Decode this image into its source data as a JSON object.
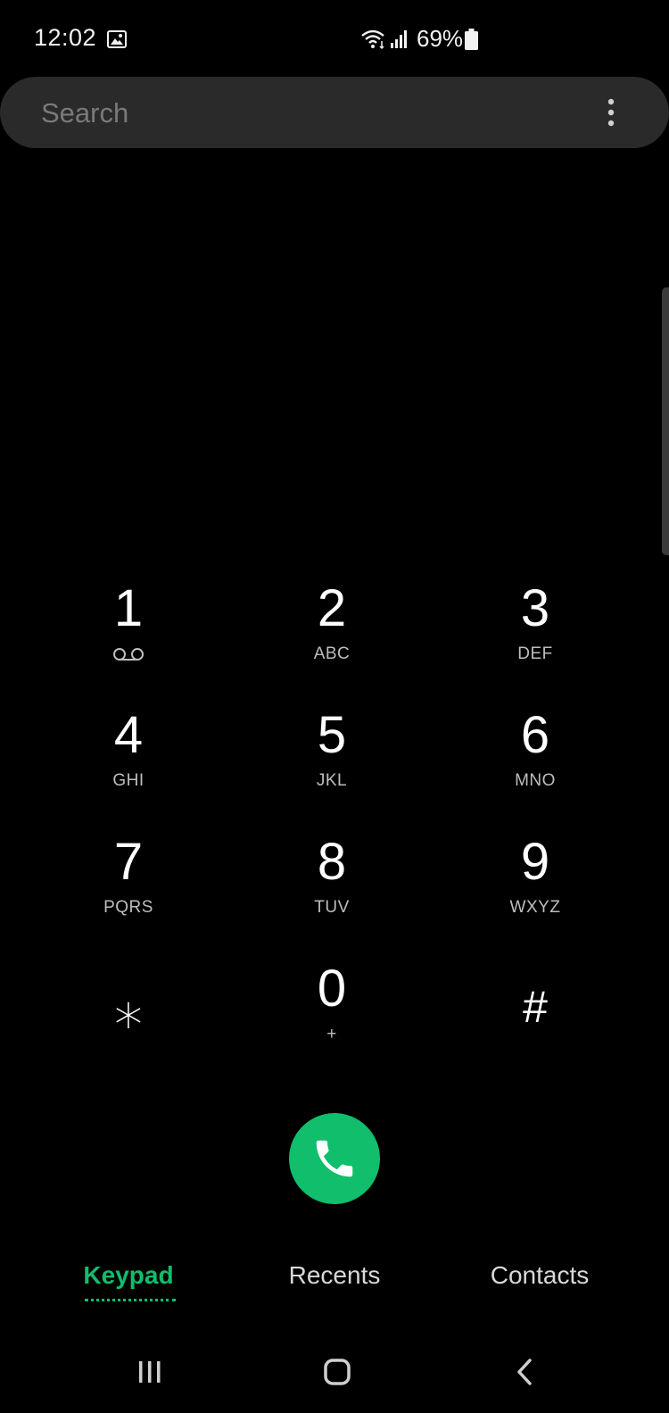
{
  "status_bar": {
    "time": "12:02",
    "battery_percent": "69%",
    "icons": [
      "gallery-icon",
      "wifi-icon",
      "signal-icon",
      "battery-icon"
    ]
  },
  "search": {
    "placeholder": "Search",
    "value": ""
  },
  "keypad": {
    "keys": [
      {
        "digit": "1",
        "letters": "",
        "icon": "voicemail-icon"
      },
      {
        "digit": "2",
        "letters": "ABC"
      },
      {
        "digit": "3",
        "letters": "DEF"
      },
      {
        "digit": "4",
        "letters": "GHI"
      },
      {
        "digit": "5",
        "letters": "JKL"
      },
      {
        "digit": "6",
        "letters": "MNO"
      },
      {
        "digit": "7",
        "letters": "PQRS"
      },
      {
        "digit": "8",
        "letters": "TUV"
      },
      {
        "digit": "9",
        "letters": "WXYZ"
      },
      {
        "digit": "⁎",
        "letters": ""
      },
      {
        "digit": "0",
        "letters": "+"
      },
      {
        "digit": "#",
        "letters": ""
      }
    ]
  },
  "call": {
    "icon": "phone-icon",
    "color": "#10be6c"
  },
  "tabs": {
    "items": [
      {
        "label": "Keypad",
        "active": true
      },
      {
        "label": "Recents",
        "active": false
      },
      {
        "label": "Contacts",
        "active": false
      }
    ],
    "accent_color": "#10be6c"
  },
  "nav_bar": {
    "icons": [
      "recent-apps-icon",
      "home-icon",
      "back-icon"
    ]
  }
}
